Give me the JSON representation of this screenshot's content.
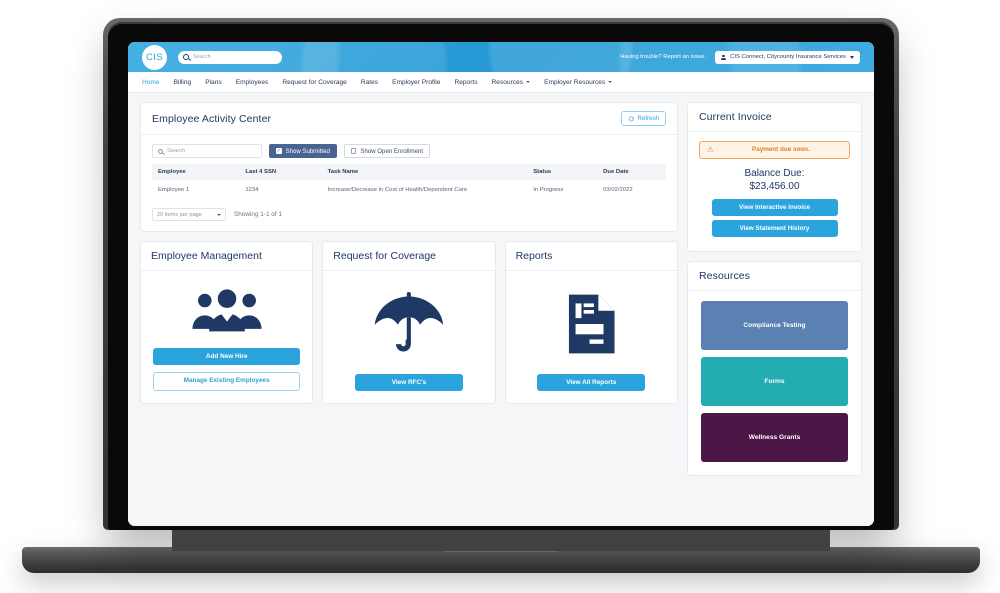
{
  "topbar": {
    "logo_text": "CIS",
    "search_placeholder": "Search",
    "trouble_text": "Having trouble? Report an issue.",
    "account_label": "CIS Connect, Citycounty Insurance Services"
  },
  "nav": {
    "items": [
      {
        "label": "Home",
        "active": true,
        "caret": false
      },
      {
        "label": "Billing",
        "active": false,
        "caret": false
      },
      {
        "label": "Plans",
        "active": false,
        "caret": false
      },
      {
        "label": "Employees",
        "active": false,
        "caret": false
      },
      {
        "label": "Request for Coverage",
        "active": false,
        "caret": false
      },
      {
        "label": "Rates",
        "active": false,
        "caret": false
      },
      {
        "label": "Employer Profile",
        "active": false,
        "caret": false
      },
      {
        "label": "Reports",
        "active": false,
        "caret": false
      },
      {
        "label": "Resources",
        "active": false,
        "caret": true
      },
      {
        "label": "Employer Resources",
        "active": false,
        "caret": true
      }
    ]
  },
  "activity": {
    "title": "Employee Activity Center",
    "refresh_label": "Refresh",
    "search_placeholder": "Search",
    "toggle_submitted": "Show Submitted",
    "toggle_open_enrollment": "Show Open Enrollment",
    "columns": [
      "Employee",
      "Last 4 SSN",
      "Task Name",
      "Status",
      "Due Date"
    ],
    "rows": [
      {
        "employee": "Employee 1",
        "ssn": "1234",
        "task": "Increase/Decrease in Cost of Health/Dependent Care",
        "status": "In Progress",
        "due": "03/02/2022"
      }
    ],
    "per_page": "20 items per page",
    "showing": "Showing 1-1 of 1"
  },
  "tiles": [
    {
      "title": "Employee Management",
      "icon": "people-group-icon",
      "primary": "Add New Hire",
      "secondary": "Manage Existing Employees"
    },
    {
      "title": "Request for Coverage",
      "icon": "umbrella-icon",
      "primary": "View RFC's",
      "secondary": null
    },
    {
      "title": "Reports",
      "icon": "report-document-icon",
      "primary": "View All Reports",
      "secondary": null
    }
  ],
  "invoice": {
    "title": "Current Invoice",
    "alert_text": "Payment due soon.",
    "alert_icon": "warning-triangle-icon",
    "balance_label": "Balance Due:",
    "balance_amount": "$23,456.00",
    "btn_interactive": "View Interactive Invoice",
    "btn_statement": "View Statement History"
  },
  "resources": {
    "title": "Resources",
    "tiles": [
      {
        "label": "Compliance Testing",
        "color": "#5b80b4"
      },
      {
        "label": "Forms",
        "color": "#23adb0"
      },
      {
        "label": "Wellness Grants",
        "color": "#4b1747"
      }
    ]
  },
  "colors": {
    "brand_blue": "#2ba4de",
    "navy": "#1f3864",
    "toggle_on": "#4a6491",
    "alert_orange": "#e2801b",
    "page_bg": "#f4f6f8"
  }
}
